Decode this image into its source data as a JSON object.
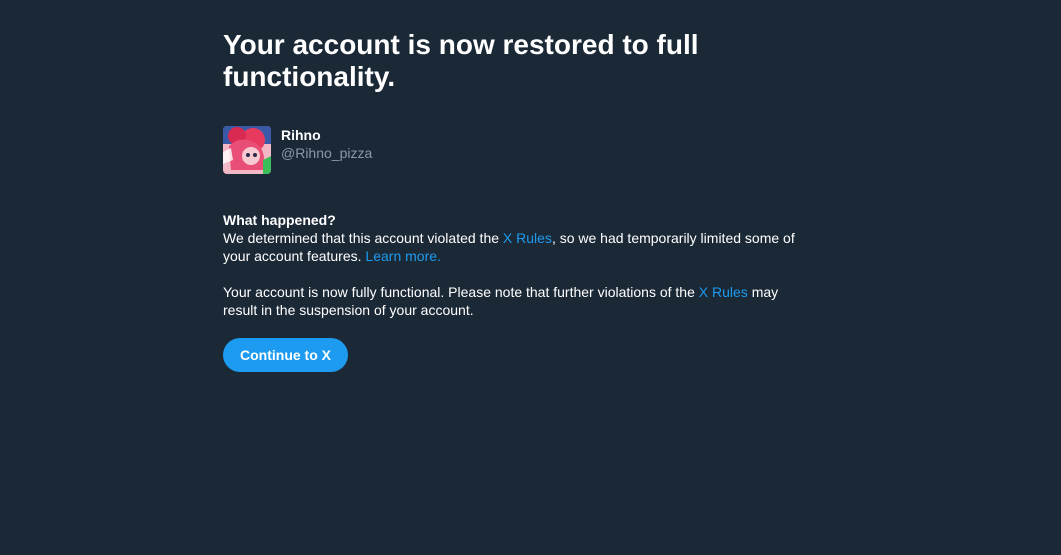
{
  "page": {
    "title": "Your account is now restored to full functionality."
  },
  "user": {
    "display_name": "Rihno",
    "handle": "@Rihno_pizza",
    "avatar_icon": "avatar-image"
  },
  "notice": {
    "heading": "What happened?",
    "paragraph1": {
      "text_before": "We determined that this account violated the ",
      "link1": "X Rules",
      "text_middle": ", so we had temporarily limited some of your account features. ",
      "link2": "Learn more."
    },
    "paragraph2": {
      "text_before": "Your account is now fully functional. Please note that further violations of the ",
      "link": "X Rules",
      "text_after": " may result in the suspension of your account."
    }
  },
  "actions": {
    "continue_label": "Continue to X"
  },
  "colors": {
    "background": "#1b2836",
    "accent": "#1d9bf0",
    "secondary_text": "#8b98a5"
  }
}
